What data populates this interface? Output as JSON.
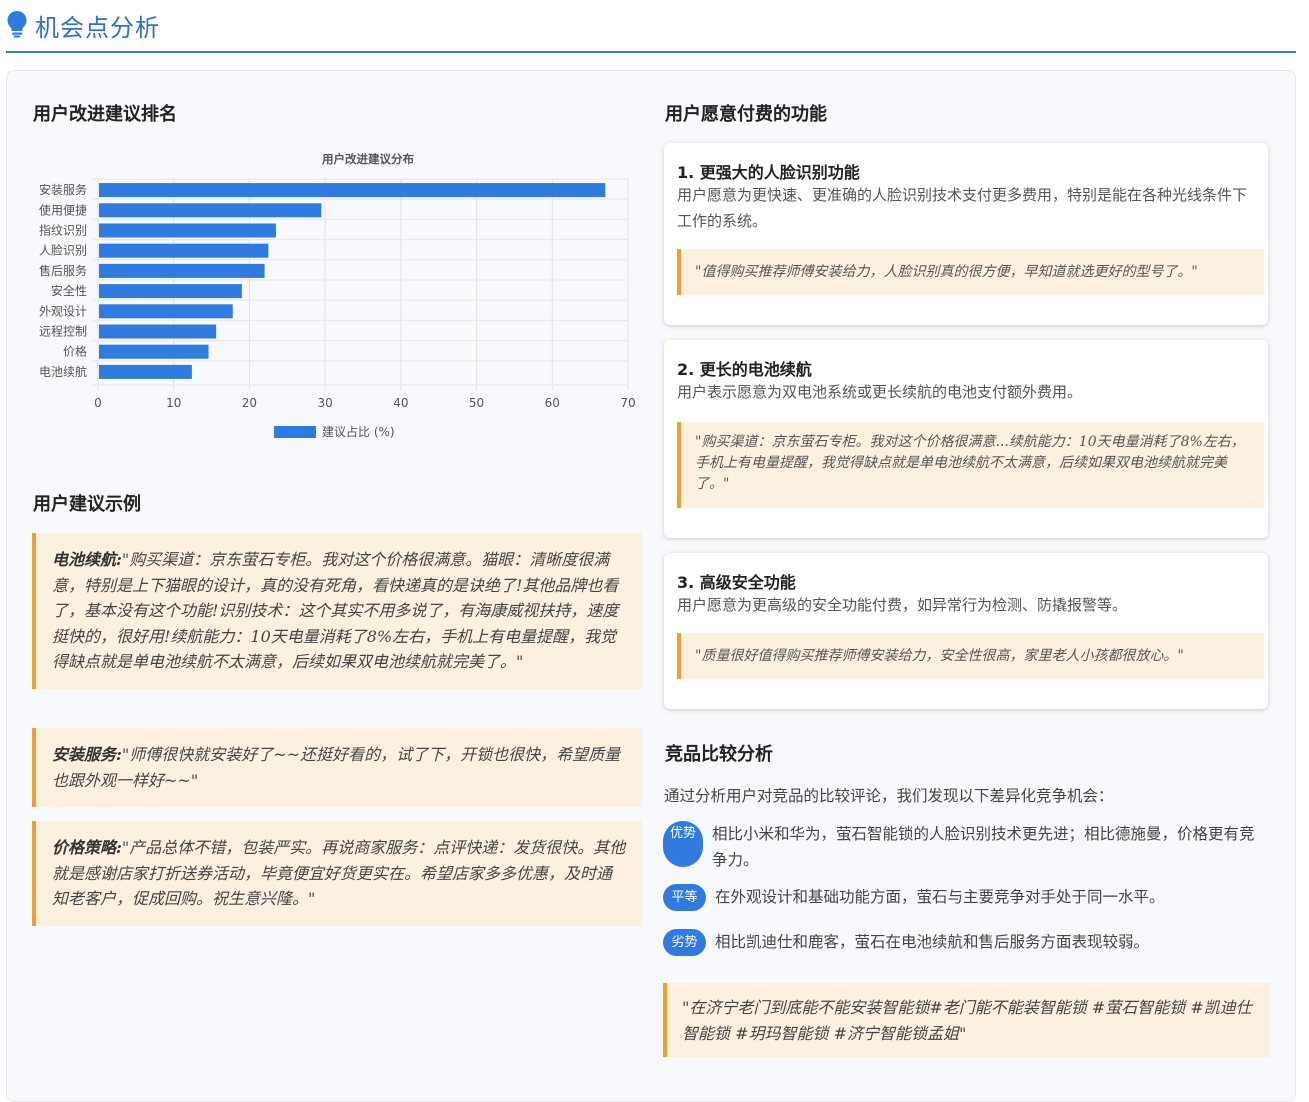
{
  "header": {
    "title": "机会点分析"
  },
  "left": {
    "ranking_title": "用户改进建议排名",
    "examples_title": "用户建议示例",
    "examples": [
      {
        "label": "电池续航:",
        "text": "\"购买渠道：京东萤石专柜。我对这个价格很满意。猫眼：清晰度很满意，特别是上下猫眼的设计，真的没有死角，看快递真的是诀绝了!其他品牌也看了，基本没有这个功能!识别技术：这个其实不用多说了，有海康威视扶持，速度挺快的，很好用!续航能力：10天电量消耗了8%左右，手机上有电量提醒，我觉得缺点就是单电池续航不太满意，后续如果双电池续航就完美了。\""
      },
      {
        "label": "安装服务:",
        "text": "\"师傅很快就安装好了~~还挺好看的，试了下，开锁也很快，希望质量也跟外观一样好~~\""
      },
      {
        "label": "价格策略:",
        "text": "\"产品总体不错，包装严实。再说商家服务：点评快递：发货很快。其他就是感谢店家打折送券活动，毕竟便宜好货更实在。希望店家多多优惠，及时通知老客户，促成回购。祝生意兴隆。\""
      }
    ]
  },
  "chart_data": {
    "type": "bar",
    "orientation": "horizontal",
    "title": "用户改进建议分布",
    "categories": [
      "安装服务",
      "使用便捷",
      "指纹识别",
      "人脸识别",
      "售后服务",
      "安全性",
      "外观设计",
      "远程控制",
      "价格",
      "电池续航"
    ],
    "series": [
      {
        "name": "建议占比 (%)",
        "values": [
          67,
          29.5,
          23.5,
          22.5,
          22,
          19,
          17.8,
          15.6,
          14.6,
          12.4
        ]
      }
    ],
    "xlim": [
      0,
      70
    ],
    "xticks": [
      0,
      10,
      20,
      30,
      40,
      50,
      60,
      70
    ],
    "grid": true,
    "legend": "bottom",
    "color": "#2f7be0"
  },
  "right": {
    "paid_title": "用户愿意付费的功能",
    "features": [
      {
        "num": "1.",
        "title": "更强大的人脸识别功能",
        "desc": "用户愿意为更快速、更准确的人脸识别技术支付更多费用，特别是能在各种光线条件下工作的系统。",
        "quote": "\"值得购买推荐师傅安装给力，人脸识别真的很方便，早知道就选更好的型号了。\""
      },
      {
        "num": "2.",
        "title": "更长的电池续航",
        "desc": "用户表示愿意为双电池系统或更长续航的电池支付额外费用。",
        "quote": "\"购买渠道：京东萤石专柜。我对这个价格很满意...续航能力：10天电量消耗了8%左右，手机上有电量提醒，我觉得缺点就是单电池续航不太满意，后续如果双电池续航就完美了。\""
      },
      {
        "num": "3.",
        "title": "高级安全功能",
        "desc": "用户愿意为更高级的安全功能付费，如异常行为检测、防撬报警等。",
        "quote": "\"质量很好值得购买推荐师傅安装给力，安全性很高，家里老人小孩都很放心。\""
      }
    ],
    "compare_title": "竞品比较分析",
    "compare_intro": "通过分析用户对竞品的比较评论，我们发现以下差异化竞争机会：",
    "compare_items": [
      {
        "badge": "优势",
        "text": "相比小米和华为，萤石智能锁的人脸识别技术更先进；相比德施曼，价格更有竞争力。"
      },
      {
        "badge": "平等",
        "text": "在外观设计和基础功能方面，萤石与主要竞争对手处于同一水平。"
      },
      {
        "badge": "劣势",
        "text": "相比凯迪仕和鹿客，萤石在电池续航和售后服务方面表现较弱。"
      }
    ],
    "bottom_quote": "\"在济宁老门到底能不能安装智能锁#老门能不能装智能锁 #萤石智能锁 #凯迪仕智能锁 #玥玛智能锁 #济宁智能锁孟姐\""
  },
  "colors": {
    "accent": "#2f6fd1",
    "bar": "#2f7be0",
    "quote_bg": "#fcf0e0",
    "quote_border": "#f0a030"
  },
  "icons": {
    "header_icon": "lightbulb-icon"
  }
}
